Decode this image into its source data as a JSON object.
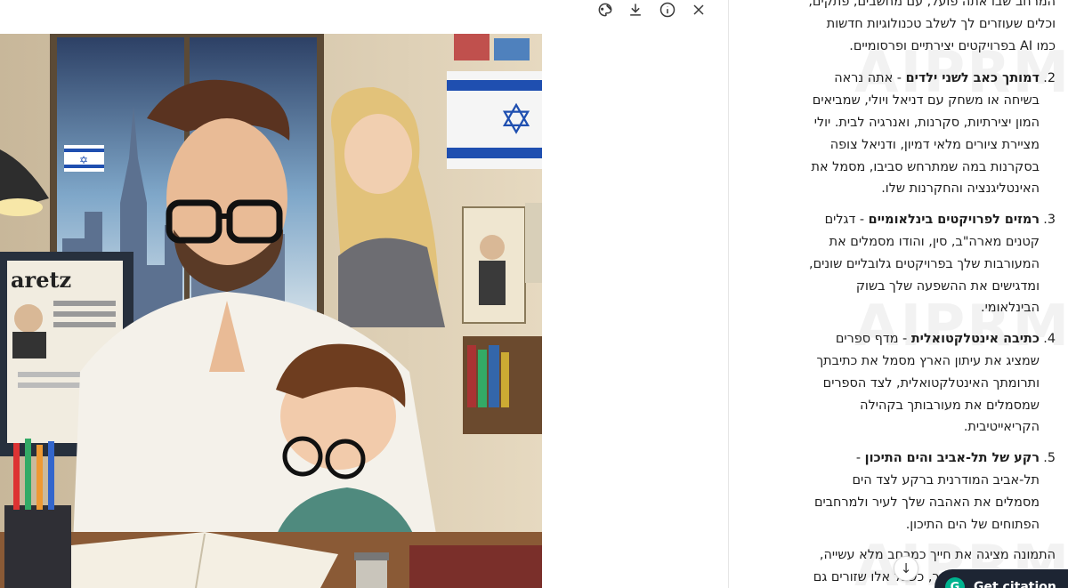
{
  "toolbar": {
    "icons": [
      "share-palette-icon",
      "download-icon",
      "info-icon",
      "close-icon"
    ]
  },
  "image": {
    "flag_star": "✡",
    "newspaper_heading": "aretz"
  },
  "text": {
    "intro_tail": "המרחב שבו אתה פועל, עם מחשבים, פתקים, וכלים שעוזרים לך לשלב טכנולוגיות חדשות כמו AI בפרויקטים יצירתיים ופרסומיים.",
    "items": [
      {
        "num": "2.",
        "title": "דמותך כאב לשני ילדים",
        "sep": " - ",
        "body": "אתה נראה בשיחה או משחק עם דניאל ויולי, שמביאים המון יצירתיות, סקרנות, ואנרגיה לבית. יולי מציירת ציורים מלאי דמיון, ודניאל צופה בסקרנות במה שמתרחש סביבו, מסמל את האינטליגנציה והחקרנות שלו."
      },
      {
        "num": "3.",
        "title": "רמזים לפרויקטים בינלאומיים",
        "sep": " - ",
        "body": "דגלים קטנים מארה\"ב, סין, והודו מסמלים את המעורבות שלך בפרויקטים גלובליים שונים, ומדגישים את ההשפעה שלך בשוק הבינלאומי."
      },
      {
        "num": "4.",
        "title": "כתיבה אינטלקטואלית",
        "sep": " - ",
        "body": "מדף ספרים שמציג את עיתון הארץ מסמל את כתיבתך ותרומתך האינטלקטואלית, לצד הספרים שמסמלים את מעורבותך בקהילה הקריאייטיבית."
      },
      {
        "num": "5.",
        "title": "רקע של תל-אביב והים התיכון",
        "sep": " - ",
        "body": "תל-אביב המודרנית ברקע לצד הים מסמלים את האהבה שלך לעיר ולמרחבים הפתוחים של הים התיכון."
      }
    ],
    "closing": "התמונה מציגה את חייך כמרחב מלא עשייה, חשיבה יצירתית, והומור, כשכל אלו שזורים גם"
  },
  "watermark": "AIPRM",
  "scroll_down_glyph": "↓",
  "cite_button": {
    "label": "Get citation",
    "logo_glyph": "G"
  }
}
